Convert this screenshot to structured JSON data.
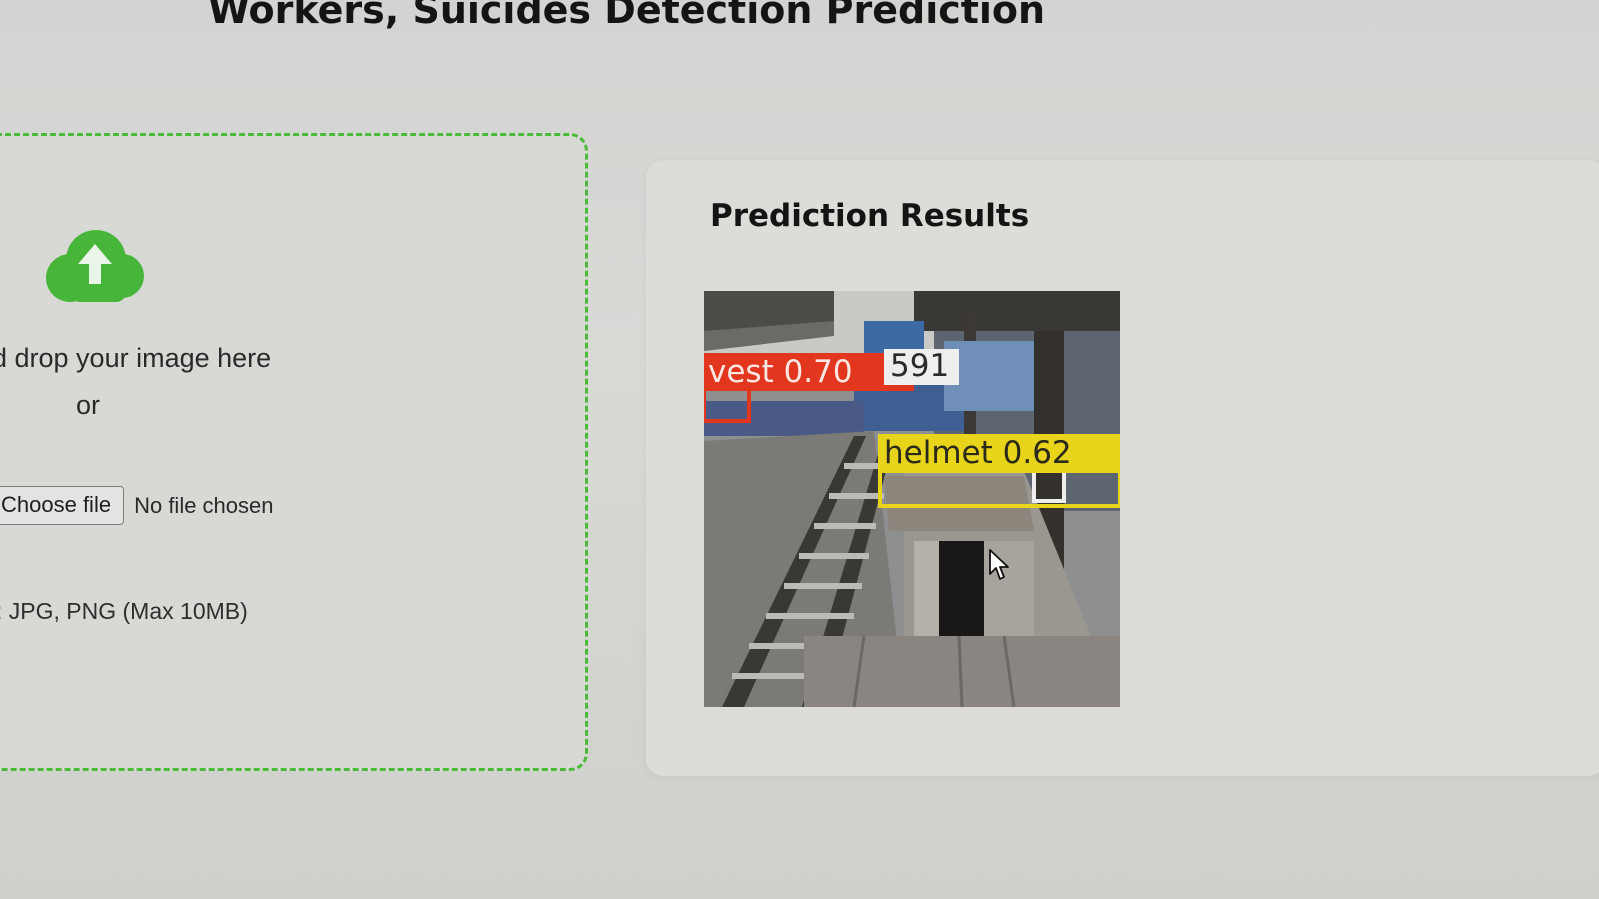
{
  "header": {
    "title": "Workers, Suicides Detection Prediction"
  },
  "upload": {
    "icon": "cloud-upload-icon",
    "accent_color": "#4cbb3a",
    "drop_text": "d drop your image here",
    "or_text": "or",
    "choose_button_label": "Choose file",
    "file_status": "No file chosen",
    "formats_text": ": JPG, PNG (Max 10MB)"
  },
  "results": {
    "heading": "Prediction Results",
    "detections": [
      {
        "text": "vest 0.70",
        "color": "#e2361f"
      },
      {
        "text": "591",
        "color": "#eeeeee"
      },
      {
        "text": "helmet  0.62",
        "color": "#e8d41b"
      }
    ]
  }
}
